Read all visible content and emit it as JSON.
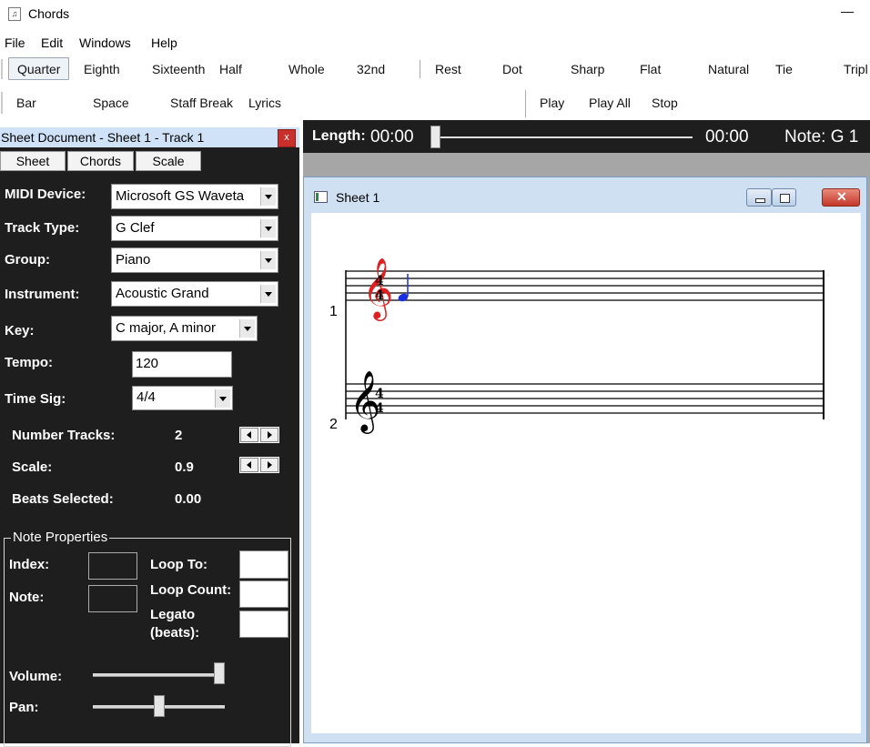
{
  "app": {
    "title": "Chords",
    "minimize_glyph": "—"
  },
  "menubar": [
    "File",
    "Edit",
    "Windows",
    "Help"
  ],
  "toolbar1": [
    "Quarter",
    "Eighth",
    "Sixteenth",
    "Half",
    "Whole",
    "32nd",
    "Rest",
    "Dot",
    "Sharp",
    "Flat",
    "Natural",
    "Tie",
    "Tripl"
  ],
  "toolbar2": [
    "Bar",
    "Space",
    "Staff Break",
    "Lyrics",
    "Play",
    "Play All",
    "Stop"
  ],
  "panel": {
    "title": "Sheet Document - Sheet 1 - Track 1",
    "close_glyph": "x",
    "tabs": [
      "Sheet",
      "Chords",
      "Scale"
    ],
    "midi_label": "MIDI Device:",
    "midi_value": "Microsoft GS Waveta",
    "track_type_label": "Track Type:",
    "track_type_value": "G Clef",
    "group_label": "Group:",
    "group_value": "Piano",
    "instrument_label": "Instrument:",
    "instrument_value": "Acoustic Grand",
    "key_label": "Key:",
    "key_value": "C major, A minor",
    "tempo_label": "Tempo:",
    "tempo_value": "120",
    "timesig_label": "Time Sig:",
    "timesig_value": "4/4",
    "num_tracks_label": "Number Tracks:",
    "num_tracks_value": "2",
    "scale_label": "Scale:",
    "scale_value": "0.9",
    "beats_label": "Beats Selected:",
    "beats_value": "0.00",
    "note_props_title": "Note Properties",
    "index_label": "Index:",
    "note_label": "Note:",
    "loop_to_label": "Loop To:",
    "loop_count_label": "Loop Count:",
    "legato_label_1": "Legato",
    "legato_label_2": "(beats):",
    "volume_label": "Volume:",
    "volume_level": 1.0,
    "pan_label": "Pan:",
    "pan_level": 0.5
  },
  "transport": {
    "length_label": "Length:",
    "length_value": "00:00",
    "position_value": "00:00",
    "note_text": "Note: G 1",
    "position_level": 0.0
  },
  "sheet_window": {
    "title": "Sheet 1",
    "track_numbers": [
      "1",
      "2"
    ],
    "time_sig_top": "4",
    "time_sig_bottom": "4"
  },
  "colors": {
    "panel_bg": "#1e1e1e",
    "clef_track1": "#e02020",
    "note_blue": "#1a2fe0",
    "header_bg": "#cfe2f7",
    "close_btn": "#c9302c"
  },
  "icons": [
    "app-icon",
    "sheet-window-icon",
    "close-icon",
    "dropdown-arrow-icon",
    "spin-left-icon",
    "spin-right-icon",
    "g-clef-icon",
    "quarter-note-icon"
  ]
}
